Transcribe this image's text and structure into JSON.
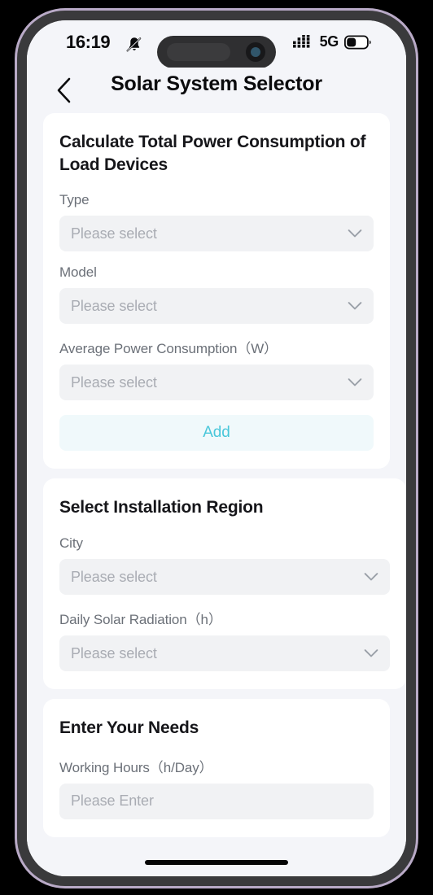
{
  "status_bar": {
    "time": "16:19",
    "bell_icon": "bell-mute-icon",
    "signal_icon": "signal-bars-icon",
    "network": "5G",
    "battery_icon": "battery-icon",
    "battery_level_percent": 40
  },
  "nav": {
    "back_icon": "chevron-left-icon",
    "title": "Solar System Selector"
  },
  "colors": {
    "accent": "#49c7da",
    "accent_bg": "#f0f9fb",
    "page_bg": "#f4f5f9",
    "card_bg": "#ffffff",
    "input_bg": "#f1f2f4",
    "label": "#6b7078",
    "placeholder": "#a9acb3"
  },
  "cards": [
    {
      "title": "Calculate Total Power Consumption of Load Devices",
      "fields": [
        {
          "label": "Type",
          "placeholder": "Please select",
          "control": "select"
        },
        {
          "label": "Model",
          "placeholder": "Please select",
          "control": "select"
        },
        {
          "label": "Average Power Consumption（W）",
          "placeholder": "Please select",
          "control": "select"
        }
      ],
      "action": {
        "label": "Add"
      }
    },
    {
      "title": "Select Installation Region",
      "fields": [
        {
          "label": "City",
          "placeholder": "Please select",
          "control": "select"
        },
        {
          "label": "Daily Solar Radiation（h）",
          "placeholder": "Please select",
          "control": "select"
        }
      ]
    },
    {
      "title": "Enter Your Needs",
      "fields": [
        {
          "label": "Working Hours（h/Day）",
          "placeholder": "Please Enter",
          "control": "input"
        }
      ]
    }
  ]
}
